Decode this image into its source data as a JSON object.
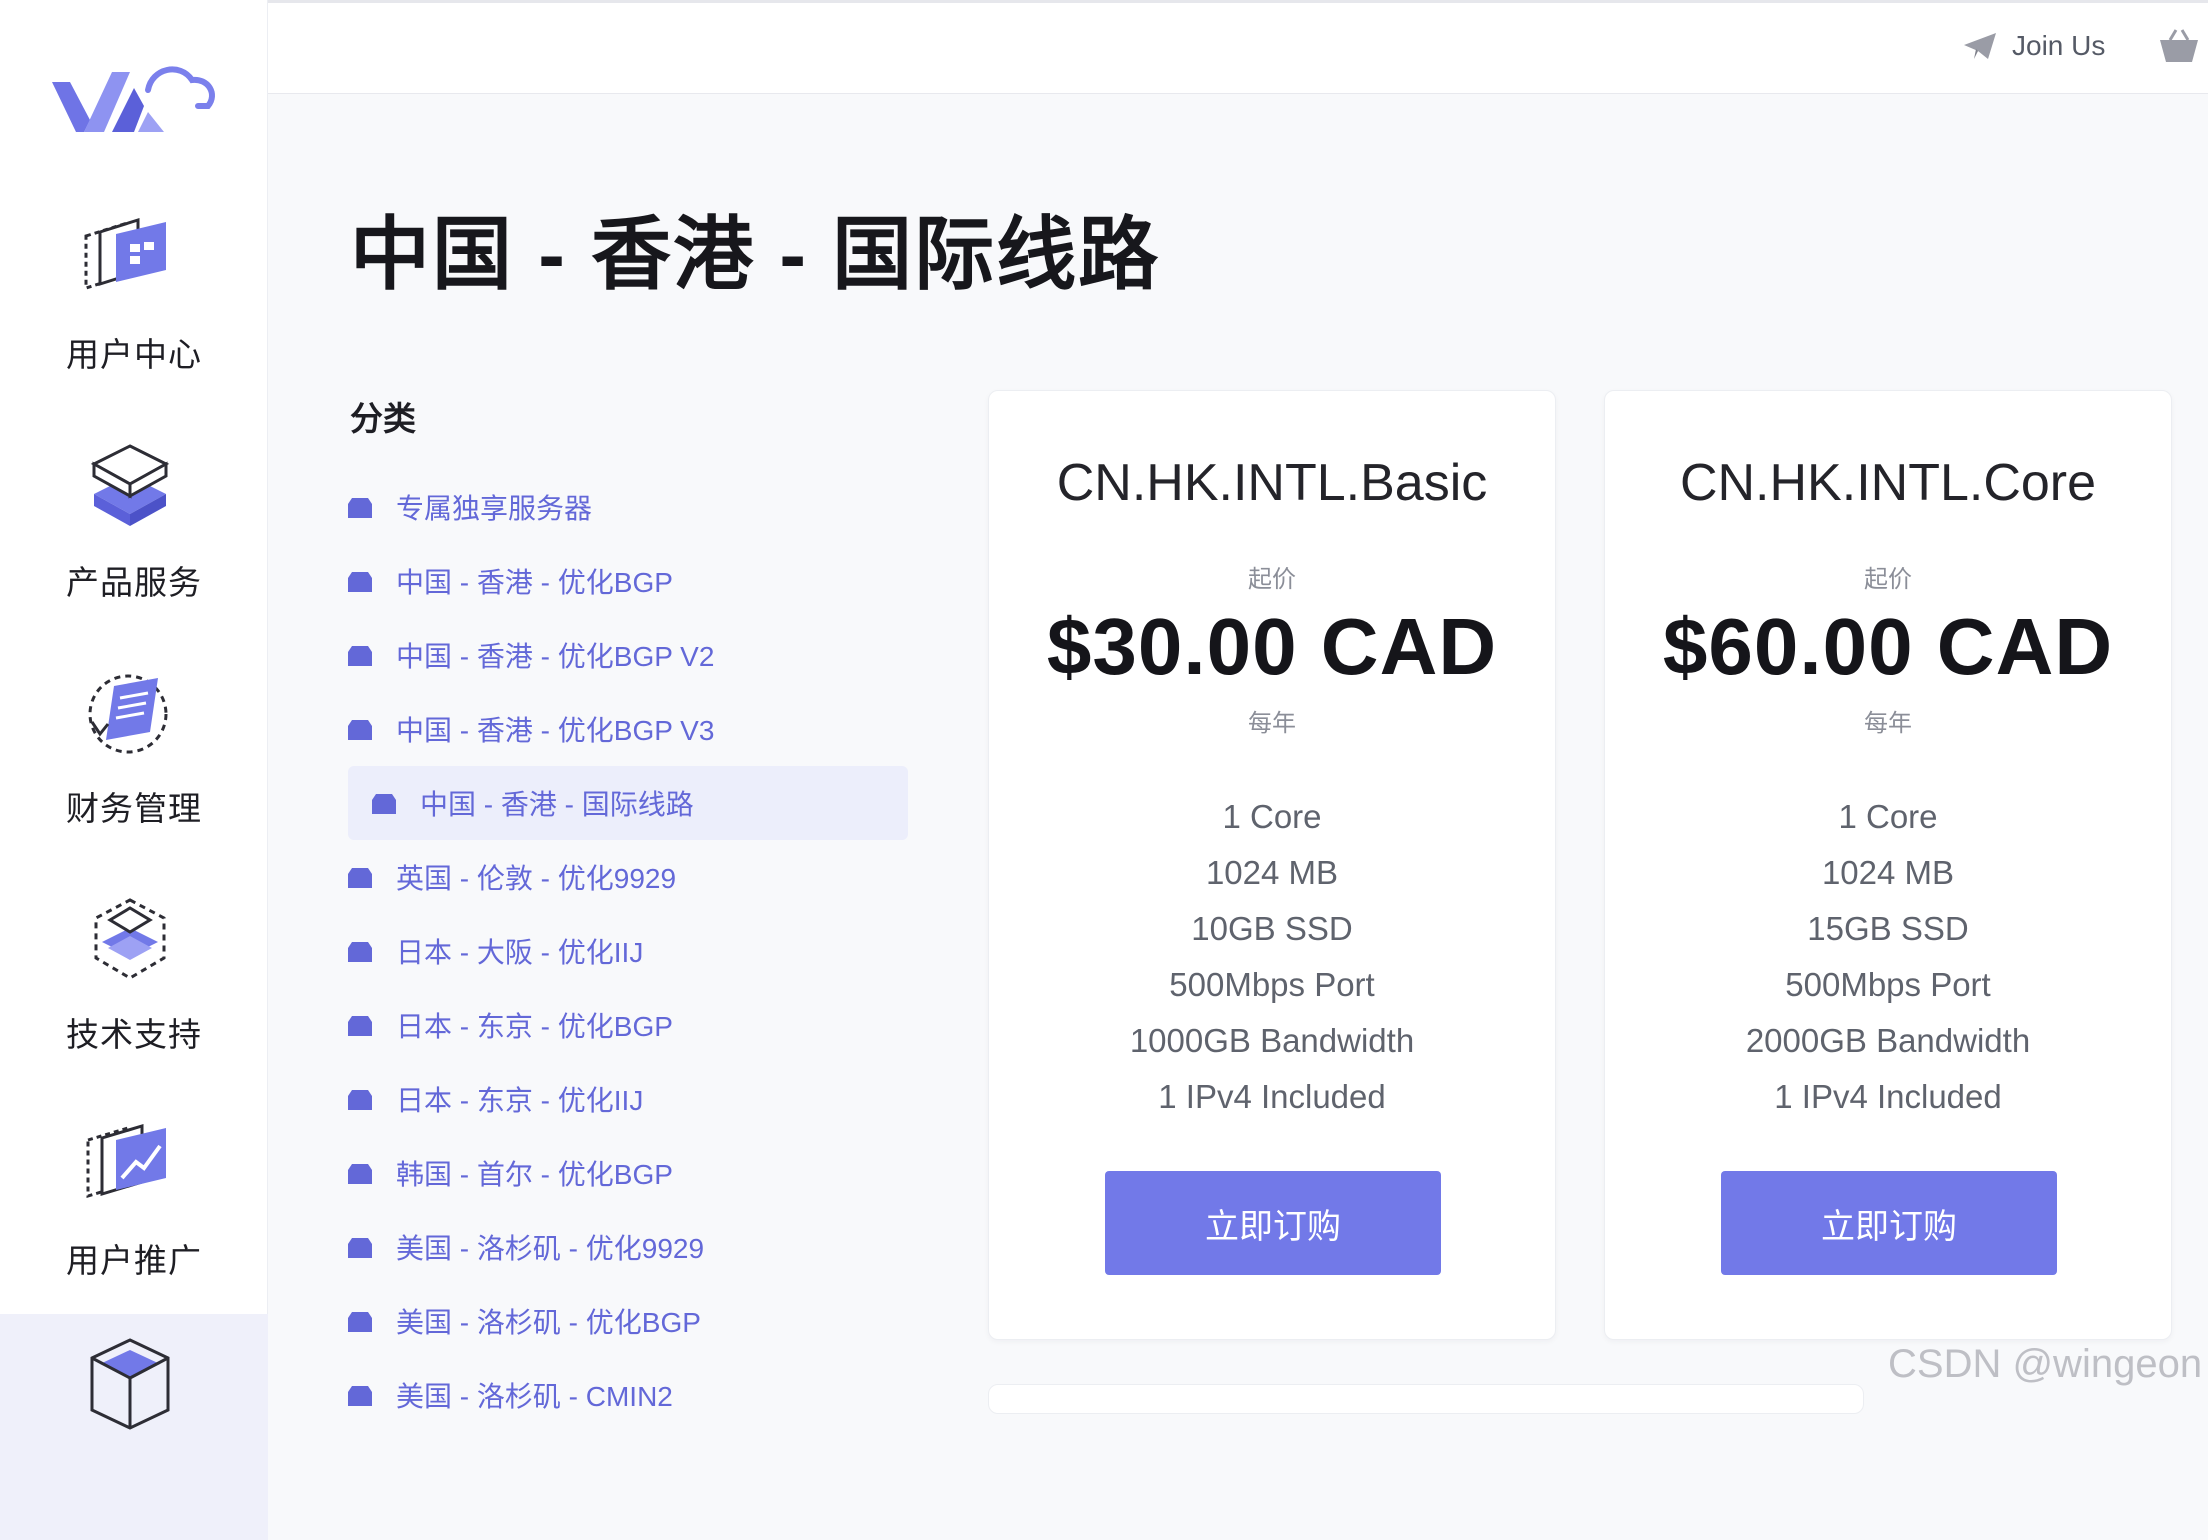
{
  "rail": {
    "items": [
      {
        "label": "用户中心",
        "icon": "user-center-icon"
      },
      {
        "label": "产品服务",
        "icon": "product-service-icon"
      },
      {
        "label": "财务管理",
        "icon": "finance-icon"
      },
      {
        "label": "技术支持",
        "icon": "support-icon"
      },
      {
        "label": "用户推广",
        "icon": "affiliate-icon"
      },
      {
        "label": "",
        "icon": "store-icon"
      }
    ]
  },
  "topbar": {
    "join_us": "Join Us"
  },
  "page": {
    "title": "中国 - 香港 - 国际线路"
  },
  "categories": {
    "heading": "分类",
    "items": [
      "专属独享服务器",
      "中国 - 香港 - 优化BGP",
      "中国 - 香港 - 优化BGP V2",
      "中国 - 香港 - 优化BGP V3",
      "中国 - 香港 - 国际线路",
      "英国 - 伦敦 - 优化9929",
      "日本 - 大阪 - 优化IIJ",
      "日本 - 东京 - 优化BGP",
      "日本 - 东京 - 优化IIJ",
      "韩国 - 首尔 - 优化BGP",
      "美国 - 洛杉矶 - 优化9929",
      "美国 - 洛杉矶 - 优化BGP",
      "美国 - 洛杉矶 - CMIN2"
    ],
    "active_index": 4
  },
  "products": [
    {
      "name": "CN.HK.INTL.Basic",
      "from_label": "起价",
      "price": "$30.00 CAD",
      "cycle": "每年",
      "specs": [
        "1 Core",
        "1024 MB",
        "10GB SSD",
        "500Mbps Port",
        "1000GB Bandwidth",
        "1 IPv4 Included"
      ],
      "button": "立即订购"
    },
    {
      "name": "CN.HK.INTL.Core",
      "from_label": "起价",
      "price": "$60.00 CAD",
      "cycle": "每年",
      "specs": [
        "1 Core",
        "1024 MB",
        "15GB SSD",
        "500Mbps Port",
        "2000GB Bandwidth",
        "1 IPv4 Included"
      ],
      "button": "立即订购"
    }
  ],
  "watermark": "CSDN @wingeon",
  "colors": {
    "accent": "#7279e8",
    "link": "#6368d8",
    "active_bg": "#eceefb"
  }
}
